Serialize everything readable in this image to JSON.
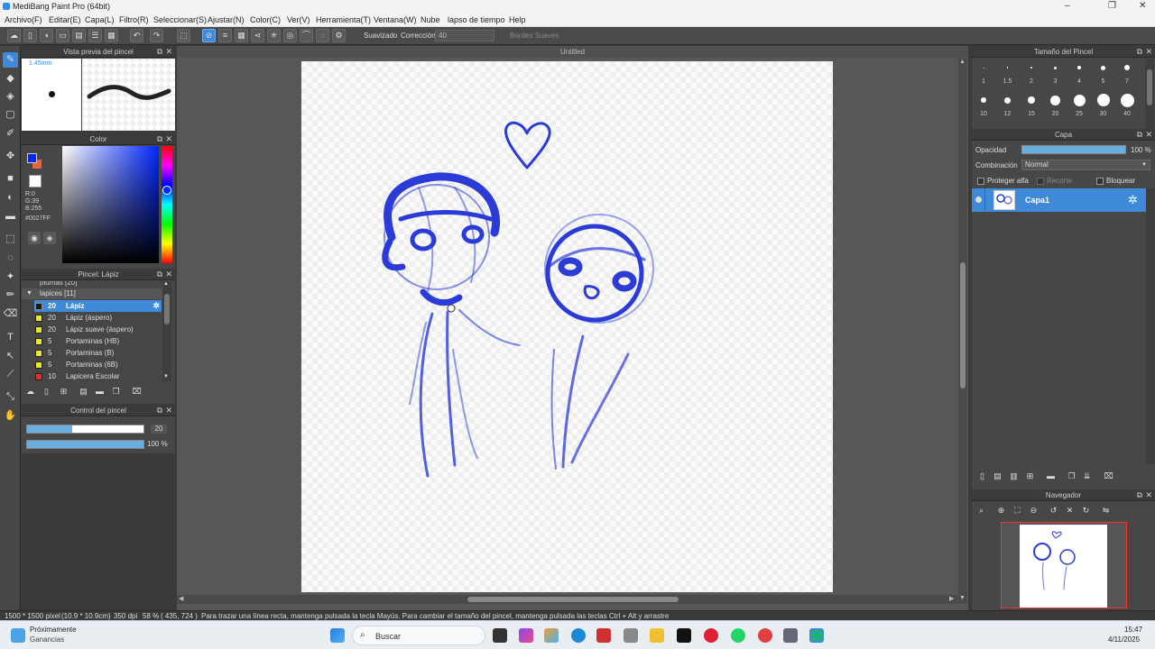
{
  "app": {
    "title": "MediBang Paint Pro (64bit)"
  },
  "menu": [
    "Archivo(F)",
    "Editar(E)",
    "Capa(L)",
    "Filtro(R)",
    "Seleccionar(S)",
    "Ajustar(N)",
    "Color(C)",
    "Ver(V)",
    "Herramienta(T)",
    "Ventana(W)",
    "Nube",
    "lapso de tiempo",
    "Help"
  ],
  "toolbar": {
    "smoothing_label": "Suavizado",
    "correction_label": "Corrección",
    "correction_value": "40",
    "soft_edges_label": "Bordes Suaves"
  },
  "brush_preview": {
    "title": "Vista previa del pincel",
    "size_text": "1.45mm"
  },
  "color_panel": {
    "title": "Color",
    "r": "R:0",
    "g": "G:39",
    "b": "B:255",
    "hex": "#0027FF",
    "primary_color": "#0027FF",
    "secondary_color": "#E8643C"
  },
  "brush_panel": {
    "title": "Pincel: Lápiz",
    "groups": [
      "plumas [20]",
      "lapices [11]"
    ],
    "items": [
      {
        "size": "20",
        "name": "Lápiz",
        "color": "#1a1a1a",
        "selected": true
      },
      {
        "size": "20",
        "name": "Lápiz (áspero)",
        "color": "#e8e82a",
        "selected": false
      },
      {
        "size": "20",
        "name": "Lápiz suave (áspero)",
        "color": "#e8e82a",
        "selected": false
      },
      {
        "size": "5",
        "name": "Portaminas (HB)",
        "color": "#e8e82a",
        "selected": false
      },
      {
        "size": "5",
        "name": "Portaminas (B)",
        "color": "#e8e82a",
        "selected": false
      },
      {
        "size": "5",
        "name": "Portaminas (6B)",
        "color": "#e8e82a",
        "selected": false
      },
      {
        "size": "10",
        "name": "Lapicera Escolar",
        "color": "#e03030",
        "selected": false
      }
    ]
  },
  "brush_control": {
    "title": "Control del pincel",
    "size_value": "20",
    "opacity_value": "100 %",
    "size_fraction": 0.39,
    "opacity_fraction": 1.0
  },
  "canvas": {
    "title": "Untitled"
  },
  "brush_size_panel": {
    "title": "Tamaño del Pincel",
    "row1": [
      "1",
      "1.5",
      "2",
      "3",
      "4",
      "5",
      "7"
    ],
    "row2": [
      "10",
      "12",
      "15",
      "20",
      "25",
      "30",
      "40"
    ]
  },
  "layer_panel": {
    "title": "Capa",
    "opacity_label": "Opacidad",
    "opacity_value": "100 %",
    "opacity_fraction": 1.0,
    "blend_label": "Combinación",
    "blend_value": "Normal",
    "protect_alpha": "Proteger alfa",
    "clipping": "Recorte",
    "lock": "Bloquear",
    "layer_name": "Capa1"
  },
  "navigator": {
    "title": "Navegador"
  },
  "status": {
    "size": "1500 * 1500 pixel",
    "physical": "(10.9 * 10.9cm)",
    "dpi": "350 dpi",
    "zoom": "58 %",
    "coords": "( 435, 724 )",
    "hint": "Para trazar una línea recta, mantenga pulsada la tecla Mayús. Para cambiar el tamaño del pincel, mantenga pulsada las teclas Ctrl + Alt y arrastre"
  },
  "taskbar": {
    "widget_title": "Próximamente",
    "widget_sub": "Ganancias",
    "search_placeholder": "Buscar",
    "time": "15:47",
    "date": "4/11/2025"
  }
}
